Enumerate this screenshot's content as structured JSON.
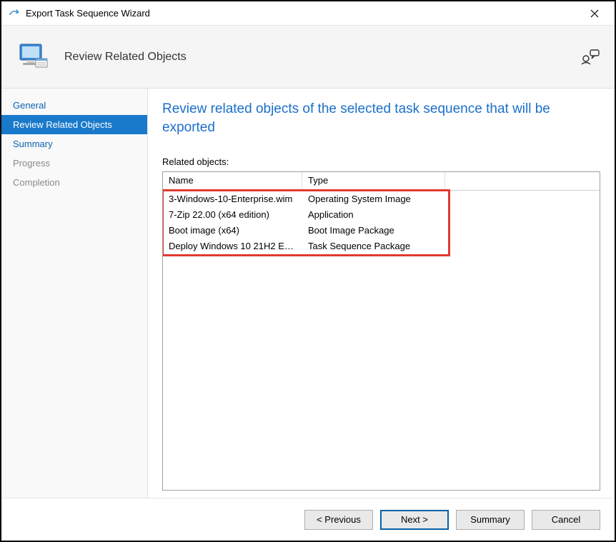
{
  "window": {
    "title": "Export Task Sequence Wizard"
  },
  "header": {
    "title": "Review Related Objects"
  },
  "sidebar": {
    "items": [
      {
        "label": "General",
        "state": "link"
      },
      {
        "label": "Review Related Objects",
        "state": "active"
      },
      {
        "label": "Summary",
        "state": "link"
      },
      {
        "label": "Progress",
        "state": "disabled"
      },
      {
        "label": "Completion",
        "state": "disabled"
      }
    ]
  },
  "main": {
    "heading": "Review related objects of the selected task sequence that will be exported",
    "related_label": "Related objects:",
    "columns": {
      "name": "Name",
      "type": "Type"
    },
    "rows": [
      {
        "name": "3-Windows-10-Enterprise.wim",
        "type": "Operating System Image"
      },
      {
        "name": "7-Zip 22.00 (x64 edition)",
        "type": "Application"
      },
      {
        "name": "Boot image (x64)",
        "type": "Boot Image Package"
      },
      {
        "name": "Deploy Windows 10 21H2 En...",
        "type": "Task Sequence Package"
      }
    ]
  },
  "footer": {
    "previous": "< Previous",
    "next": "Next >",
    "summary": "Summary",
    "cancel": "Cancel"
  }
}
